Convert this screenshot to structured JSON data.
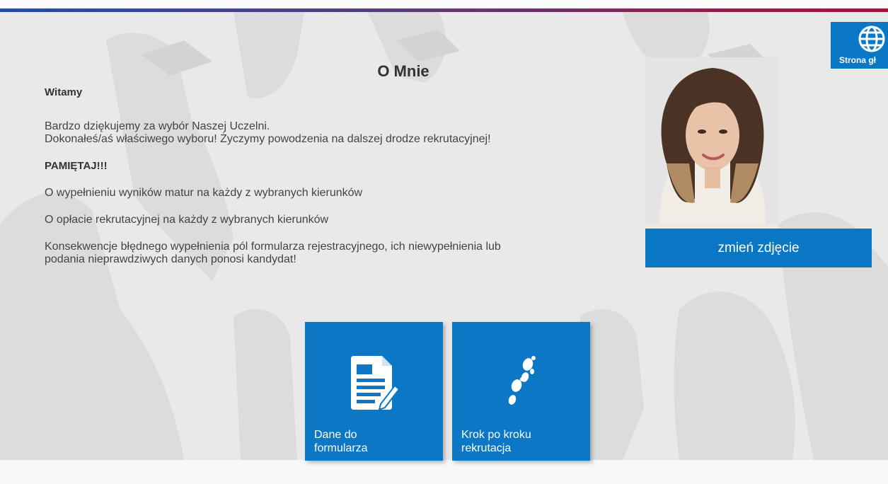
{
  "page": {
    "heading": "O Mnie",
    "greeting": "Witamy",
    "intro_line1": "Bardzo dziękujemy za wybór Naszej Uczelni.",
    "intro_line2": "Dokonałeś/aś właściwego wyboru! Życzymy powodzenia na dalszej drodze rekrutacyjnej!",
    "remember": "PAMIĘTAJ!!!",
    "reminder1": "O wypełnieniu wyników matur na każdy z wybranych kierunków",
    "reminder2": "O opłacie rekrutacyjnej na każdy z wybranych kierunków",
    "warning_line1": "Konsekwencje błędnego wypełnienia pól formularza rejestracyjnego, ich niewypełnienia lub",
    "warning_line2": "podania nieprawdziwych danych ponosi kandydat!"
  },
  "profile": {
    "change_photo_label": "zmień zdjęcie"
  },
  "tiles": [
    {
      "line1": "Dane do",
      "line2": "formularza",
      "icon": "form-document-icon"
    },
    {
      "line1": "Krok po kroku",
      "line2": "rekrutacja",
      "icon": "footsteps-icon"
    }
  ],
  "home_button": {
    "label": "Strona gł",
    "icon": "globe-icon"
  },
  "colors": {
    "accent": "#0b77c5",
    "top_bar_left": "#1f4f9c",
    "top_bar_right": "#a3153a",
    "background": "#e9e9e9"
  }
}
